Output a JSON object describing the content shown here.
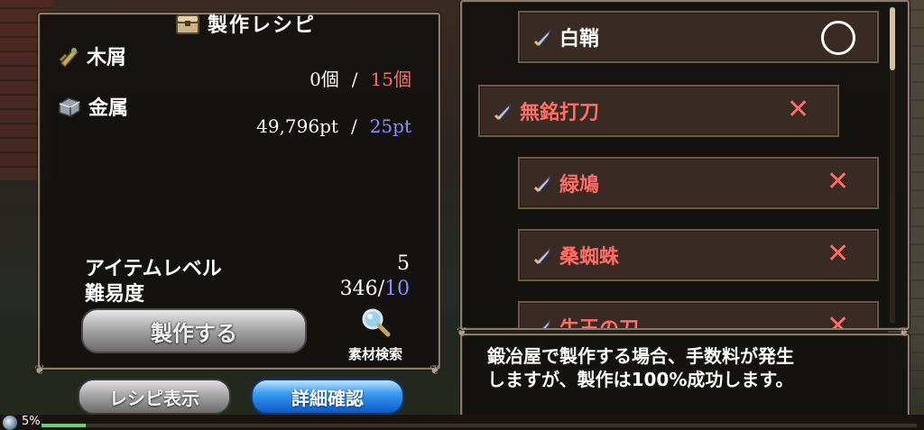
{
  "title": "製作レシピ",
  "materials": [
    {
      "name": "木屑",
      "icon": "wood-scrap-icon",
      "have": "0個",
      "need": "15個"
    },
    {
      "name": "金属",
      "icon": "metal-icon",
      "have": "49,796pt",
      "need": "25pt"
    }
  ],
  "slash": "/",
  "stats": {
    "item_level_label": "アイテムレベル",
    "item_level_value": "5",
    "difficulty_label": "難易度",
    "difficulty_value": "346",
    "difficulty_max": "10"
  },
  "buttons": {
    "craft": "製作する",
    "search": "素材検索",
    "recipe": "レシピ表示",
    "detail": "詳細確認"
  },
  "recipes": [
    {
      "name": "白鞘",
      "status": "○",
      "craftable": true
    },
    {
      "name": "無銘打刀",
      "status": "✕",
      "craftable": false
    },
    {
      "name": "緑鳩",
      "status": "✕",
      "craftable": false
    },
    {
      "name": "桑蜘蛛",
      "status": "✕",
      "craftable": false
    },
    {
      "name": "牛王の刀",
      "status": "✕",
      "craftable": false
    }
  ],
  "info": {
    "line1": "鍛冶屋で製作する場合、手数料が発生",
    "line2": "しますが、製作は100%成功します。"
  },
  "progress": {
    "label": "5%",
    "value": 0.05
  },
  "colors": {
    "insufficient": "#ff6e66",
    "required_ok": "#8f8cff",
    "detail_button": "#1a7ae0"
  }
}
